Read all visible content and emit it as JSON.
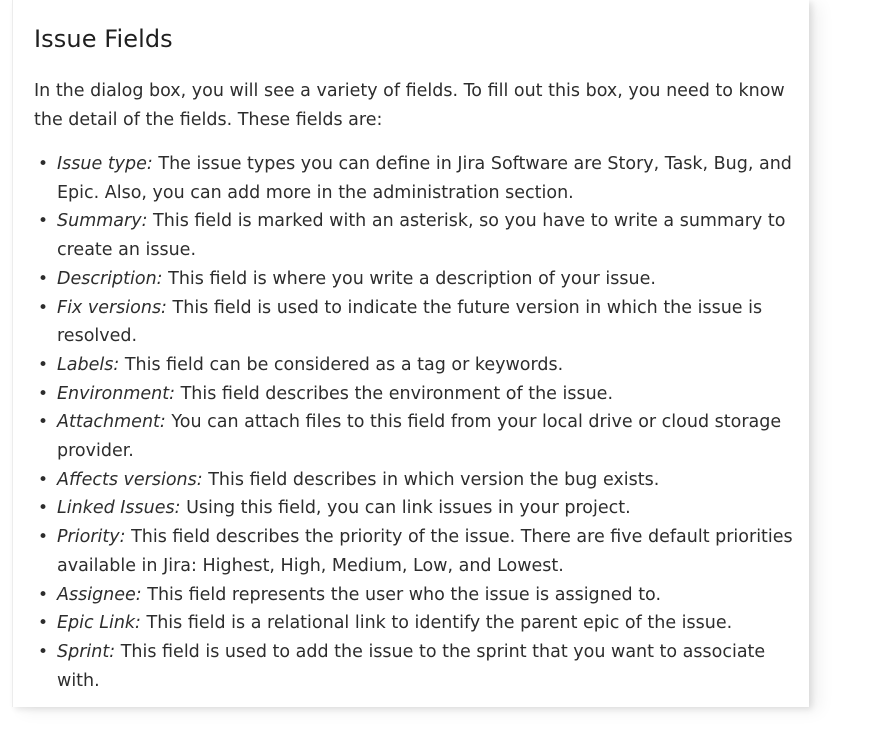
{
  "article": {
    "title": "Issue Fields",
    "intro": "In the dialog box, you will see a variety of fields. To fill out this box, you need to know the detail of the fields. These fields are:",
    "fields": [
      {
        "name": "Issue type:",
        "desc": "The issue types you can define in Jira Software are Story, Task, Bug, and Epic. Also, you can add more in the administration section."
      },
      {
        "name": "Summary:",
        "desc": "This field is marked with an asterisk, so you have to write a summary to create an issue."
      },
      {
        "name": "Description:",
        "desc": "This field is where you write a description of your issue."
      },
      {
        "name": "Fix versions:",
        "desc": "This field is used to indicate the future version in which the issue is resolved."
      },
      {
        "name": "Labels:",
        "desc": "This field can be considered as a tag or keywords."
      },
      {
        "name": "Environment:",
        "desc": "This field describes the environment of the issue."
      },
      {
        "name": "Attachment:",
        "desc": "You can attach files to this field from your local drive or cloud storage provider."
      },
      {
        "name": "Affects versions:",
        "desc": "This field describes in which version the bug exists."
      },
      {
        "name": "Linked Issues:",
        "desc": "Using this field, you can link issues in your project."
      },
      {
        "name": "Priority:",
        "desc": "This field describes the priority of the issue. There are five default priorities available in Jira: Highest, High, Medium, Low, and Lowest."
      },
      {
        "name": "Assignee:",
        "desc": "This field represents the user who the issue is assigned to."
      },
      {
        "name": "Epic Link:",
        "desc": "This field is a relational link to identify the parent epic of the issue."
      },
      {
        "name": "Sprint:",
        "desc": "This field is used to add the issue to the sprint that you want to associate with."
      }
    ]
  }
}
